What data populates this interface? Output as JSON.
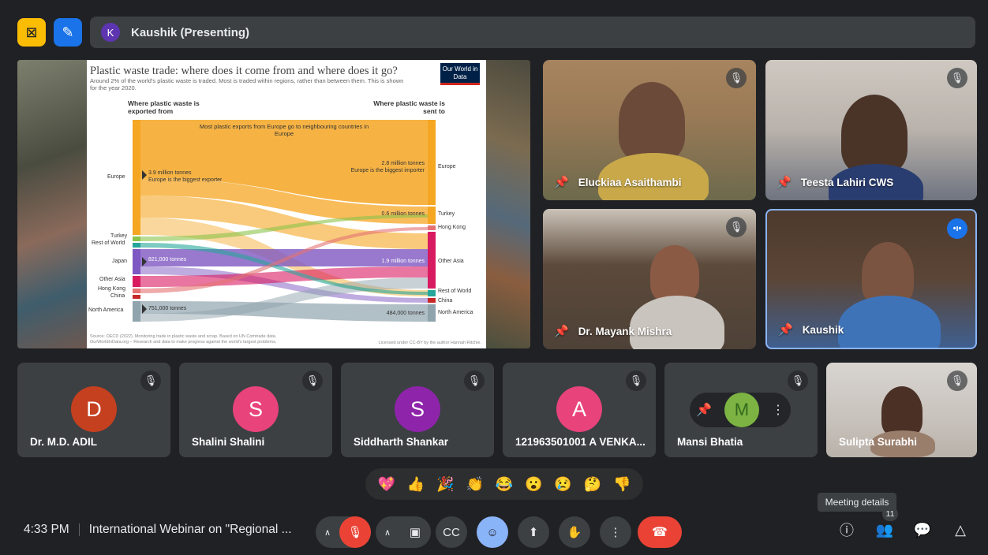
{
  "topbar": {
    "presenter_initial": "K",
    "presenter_label": "Kaushik (Presenting)",
    "icon_left_1": "no-presenting-icon",
    "icon_left_2": "pen-icon"
  },
  "slide": {
    "title": "Plastic waste trade: where does it come from and where does it go?",
    "subtitle": "Around 2% of the world's plastic waste is traded. Most is traded within regions, rather than between them. This is shown for the year 2020.",
    "logo": "Our World in Data",
    "header_left": "Where plastic waste is exported from",
    "header_right": "Where plastic waste is sent to",
    "annotation_top": "Most plastic exports from Europe go to neighbouring countries in Europe",
    "left_labels": [
      "Europe",
      "Turkey",
      "Rest of World",
      "Japan",
      "Other Asia",
      "Hong Kong",
      "China",
      "North America"
    ],
    "right_labels": [
      "Europe",
      "Turkey",
      "Hong Kong",
      "Other Asia",
      "Rest of World",
      "China",
      "North America"
    ],
    "europe_export": "3.9 million tonnes",
    "europe_export_note": "Europe is the biggest exporter",
    "europe_import": "2.8 million tonnes",
    "europe_import_note": "Europe is the biggest importer",
    "turkey_import": "0.6 million tonnes",
    "japan_export": "821,000 tonnes",
    "other_asia_import": "1.9 million tonnes",
    "na_export": "751,000 tonnes",
    "na_import": "484,000 tonnes",
    "source": "Source: OECD (2022). Monitoring trade in plastic waste and scrap. Based on UN Comtrade data.",
    "source2": "OurWorldInData.org – Research and data to make progress against the world's largest problems.",
    "license": "Licensed under CC-BY by the author Hannah Ritchie."
  },
  "tiles": [
    {
      "name": "Eluckiaa Asaithambi"
    },
    {
      "name": "Teesta Lahiri CWS"
    },
    {
      "name": "Dr. Mayank Mishra"
    },
    {
      "name": "Kaushik"
    }
  ],
  "small_tiles": [
    {
      "initial": "D",
      "name": "Dr. M.D. ADIL",
      "color": "#c5401f"
    },
    {
      "initial": "S",
      "name": "Shalini Shalini",
      "color": "#e8437a"
    },
    {
      "initial": "S",
      "name": "Siddharth Shankar",
      "color": "#8e24aa"
    },
    {
      "initial": "A",
      "name": "121963501001 A VENKA...",
      "color": "#e8437a"
    },
    {
      "initial": "M",
      "name": "Mansi Bhatia",
      "color": "#7cb342"
    },
    {
      "initial": "",
      "name": "Sulipta Surabhi",
      "color": ""
    }
  ],
  "reactions": [
    "💖",
    "👍",
    "🎉",
    "👏",
    "😂",
    "😮",
    "😢",
    "🤔",
    "👎"
  ],
  "bottom": {
    "time": "4:33 PM",
    "meeting_title": "International Webinar on \"Regional ...",
    "participants_count": "11",
    "tooltip": "Meeting details"
  }
}
